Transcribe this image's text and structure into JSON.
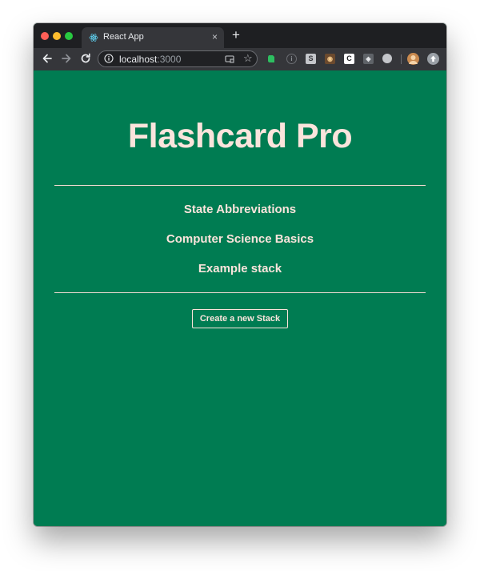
{
  "browser": {
    "tab_title": "React App",
    "tab_close": "×",
    "new_tab": "+",
    "url_host": "localhost",
    "url_port": ":3000",
    "star": "☆",
    "extensions": [
      {
        "name": "evernote-icon",
        "glyph": ""
      },
      {
        "name": "info-extension-icon",
        "glyph": "i"
      },
      {
        "name": "s-extension-icon",
        "glyph": "S"
      },
      {
        "name": "honey-extension-icon",
        "glyph": "◉"
      },
      {
        "name": "c-extension-icon",
        "glyph": "C"
      },
      {
        "name": "shield-extension-icon",
        "glyph": "◈"
      },
      {
        "name": "circle-extension-icon",
        "glyph": ""
      }
    ]
  },
  "app": {
    "title": "Flashcard Pro",
    "stacks": [
      {
        "label": "State Abbreviations"
      },
      {
        "label": "Computer Science Basics"
      },
      {
        "label": "Example stack"
      }
    ],
    "create_button_label": "Create a new Stack"
  },
  "colors": {
    "background": "#007c52",
    "text": "#fbe4dc",
    "browser_chrome": "#35363a"
  }
}
